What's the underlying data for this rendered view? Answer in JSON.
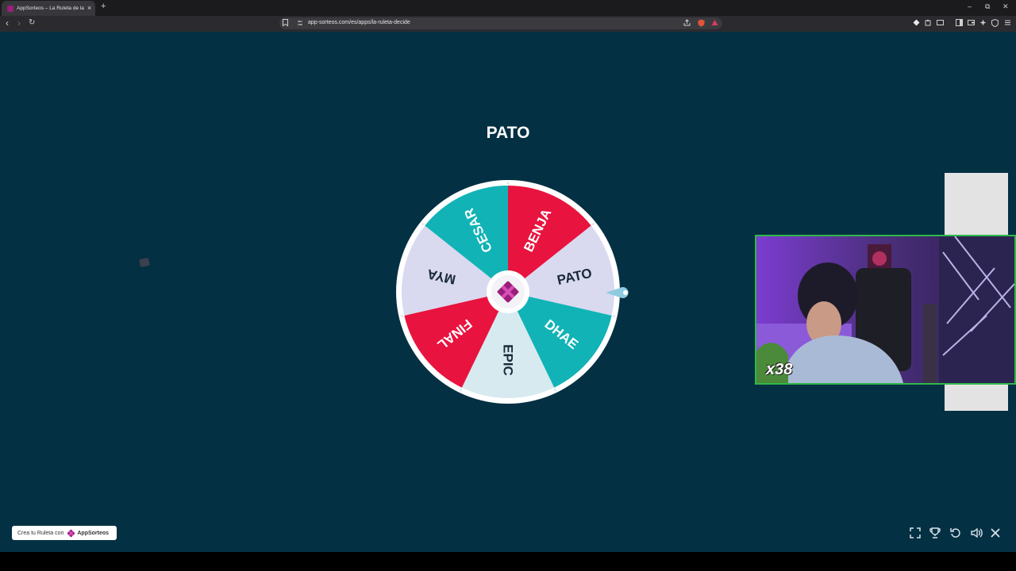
{
  "browser": {
    "tab_title": "AppSorteos – La Ruleta de la Suerte",
    "tab_close": "×",
    "new_tab": "+",
    "url": "app-sorteos.com/es/apps/la-ruleta-decide",
    "window_controls": {
      "minimize": "–",
      "restore": "⧉",
      "close": "✕"
    },
    "nav": {
      "back": "‹",
      "forward": "›",
      "reload": "↻"
    }
  },
  "wheel": {
    "winner": "PATO",
    "slices": [
      {
        "label": "BENJA",
        "color": "#e8133e",
        "text_color": "#ffffff"
      },
      {
        "label": "PATO",
        "color": "#d9d9f0",
        "text_color": "#1a2a3a"
      },
      {
        "label": "DHAE",
        "color": "#11b3b6",
        "text_color": "#ffffff"
      },
      {
        "label": "EPIC",
        "color": "#d6eaf0",
        "text_color": "#1a2a3a"
      },
      {
        "label": "FINAL",
        "color": "#e8133e",
        "text_color": "#ffffff"
      },
      {
        "label": "MYA",
        "color": "#d9d9f0",
        "text_color": "#1a2a3a"
      },
      {
        "label": "CESAR",
        "color": "#11b3b6",
        "text_color": "#ffffff"
      }
    ],
    "center_logo_color": "#9b1f7a"
  },
  "stream_overlay": {
    "badge": "x38"
  },
  "promo": {
    "text": "Crea tu Ruleta con",
    "brand": "AppSorteos"
  },
  "controls": {
    "fullscreen": "fullscreen-icon",
    "trophy": "trophy-icon",
    "reset": "reset-icon",
    "volume": "volume-icon",
    "close": "close-icon"
  },
  "colors": {
    "page_background": "#033042",
    "accent_magenta": "#9b1f7a",
    "webcam_border": "#2fb84a"
  }
}
